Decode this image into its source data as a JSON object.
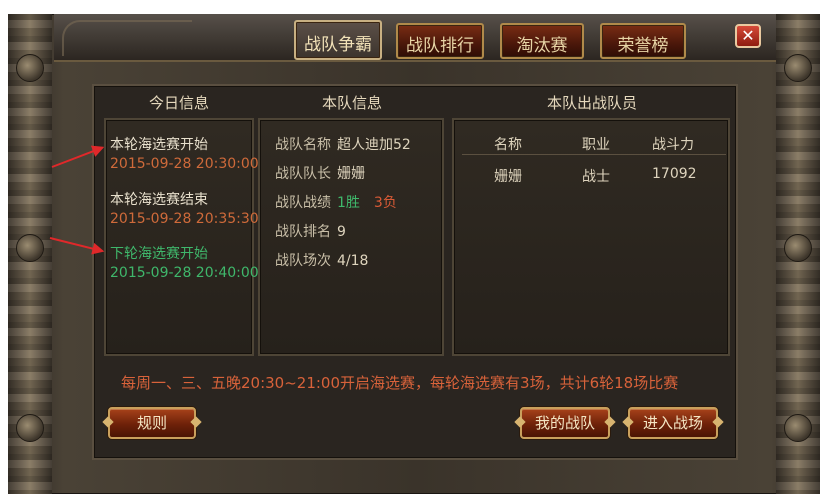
{
  "tabs": [
    {
      "label": "战队争霸",
      "active": true
    },
    {
      "label": "战队排行",
      "active": false
    },
    {
      "label": "淘汰赛",
      "active": false
    },
    {
      "label": "荣誉榜",
      "active": false
    }
  ],
  "close_label": "✕",
  "today": {
    "title": "今日信息",
    "events": [
      {
        "label": "本轮海选赛开始",
        "time": "2015-09-28 20:30:00"
      },
      {
        "label": "本轮海选赛结束",
        "time": "2015-09-28 20:35:30"
      },
      {
        "label": "下轮海选赛开始",
        "time": "2015-09-28 20:40:00"
      }
    ]
  },
  "team": {
    "title": "本队信息",
    "name_label": "战队名称",
    "name": "超人迪加52",
    "leader_label": "战队队长",
    "leader": "姗姗",
    "record_label": "战队战绩",
    "wins": "1胜",
    "losses": "3负",
    "rank_label": "战队排名",
    "rank": "9",
    "matches_label": "战队场次",
    "matches": "4/18"
  },
  "roster": {
    "title": "本队出战队员",
    "headers": [
      "名称",
      "职业",
      "战斗力"
    ],
    "rows": [
      [
        "姗姗",
        "战士",
        "17092"
      ]
    ]
  },
  "notice": "每周一、三、五晚20:30~21:00开启海选赛，每轮海选赛有3场，共计6轮18场比赛",
  "buttons": {
    "rules": "规则",
    "my_team": "我的战队",
    "enter": "进入战场"
  },
  "colors": {
    "accent_orange": "#cf6a3a",
    "accent_green": "#3fb76b",
    "annotation_red": "#e0282a"
  }
}
